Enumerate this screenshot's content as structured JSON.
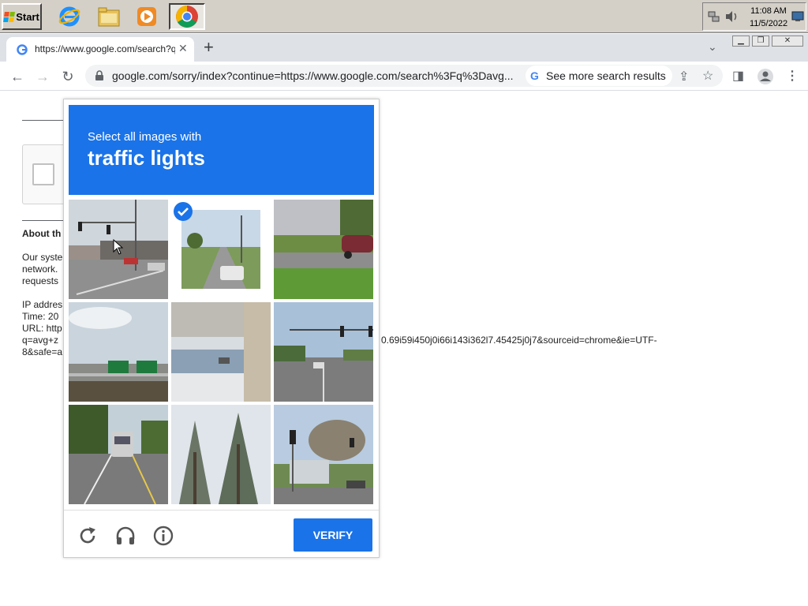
{
  "taskbar": {
    "start_label": "Start",
    "apps": [
      "internet-explorer",
      "file-explorer",
      "media-player",
      "chrome"
    ],
    "clock_time": "11:08 AM",
    "clock_date": "11/5/2022"
  },
  "browser": {
    "tab_title": "https://www.google.com/search?q=",
    "url": "google.com/sorry/index?continue=https://www.google.com/search%3Fq%3Davg...",
    "chip_text": "See more search results"
  },
  "page": {
    "about_heading": "About th",
    "text_lines": [
      "Our syste",
      "network.",
      "requests"
    ],
    "info_lines": [
      "IP addres",
      "Time: 20",
      "URL: http",
      "q=avg+z",
      "8&safe=a"
    ],
    "url_tail_1": "0.69i59i450j0i66i143i362l7.45425j0j7&sourceid=chrome&ie=UTF-"
  },
  "captcha": {
    "instruction": "Select all images with",
    "target": "traffic lights",
    "verify_label": "VERIFY",
    "tiles": [
      {
        "index": 1,
        "desc": "intersection with traffic lights",
        "selected": false
      },
      {
        "index": 2,
        "desc": "road with car",
        "selected": true
      },
      {
        "index": 3,
        "desc": "car near grass",
        "selected": false
      },
      {
        "index": 4,
        "desc": "highway overpass with signs",
        "selected": false
      },
      {
        "index": 5,
        "desc": "overpass from below",
        "selected": false
      },
      {
        "index": 6,
        "desc": "intersection with traffic signals",
        "selected": false
      },
      {
        "index": 7,
        "desc": "bus on road",
        "selected": false
      },
      {
        "index": 8,
        "desc": "trees",
        "selected": false
      },
      {
        "index": 9,
        "desc": "street corner with traffic light",
        "selected": false
      }
    ]
  },
  "colors": {
    "accent": "#1a73e8",
    "taskbar": "#d4d0c8"
  }
}
